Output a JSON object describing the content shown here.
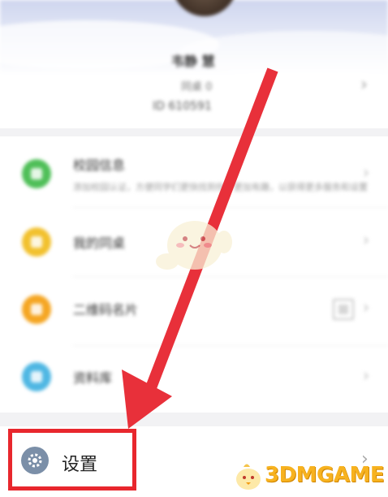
{
  "profile": {
    "name": "韦静 慧",
    "subtitle": "同桌 0",
    "id_text": "ID 610591"
  },
  "menu": [
    {
      "label": "校园信息",
      "desc": "添加校园认证，方便同学们更快找到你，更加有趣，以获得更多服务和设置",
      "color": "#4fbf58",
      "icon": "campus-icon"
    },
    {
      "label": "我的同桌",
      "desc": "",
      "color": "#f2c12e",
      "icon": "deskmate-icon"
    },
    {
      "label": "二维码名片",
      "desc": "",
      "color": "#f5a623",
      "icon": "qrcode-card-icon"
    },
    {
      "label": "资料库",
      "desc": "",
      "color": "#4fb7e3",
      "icon": "library-icon"
    }
  ],
  "settings": {
    "label": "设置",
    "icon": "gear-icon"
  },
  "watermark": {
    "text": "3DMGAME"
  },
  "colors": {
    "highlight": "#e8272d",
    "watermark": "#f7b21f"
  }
}
